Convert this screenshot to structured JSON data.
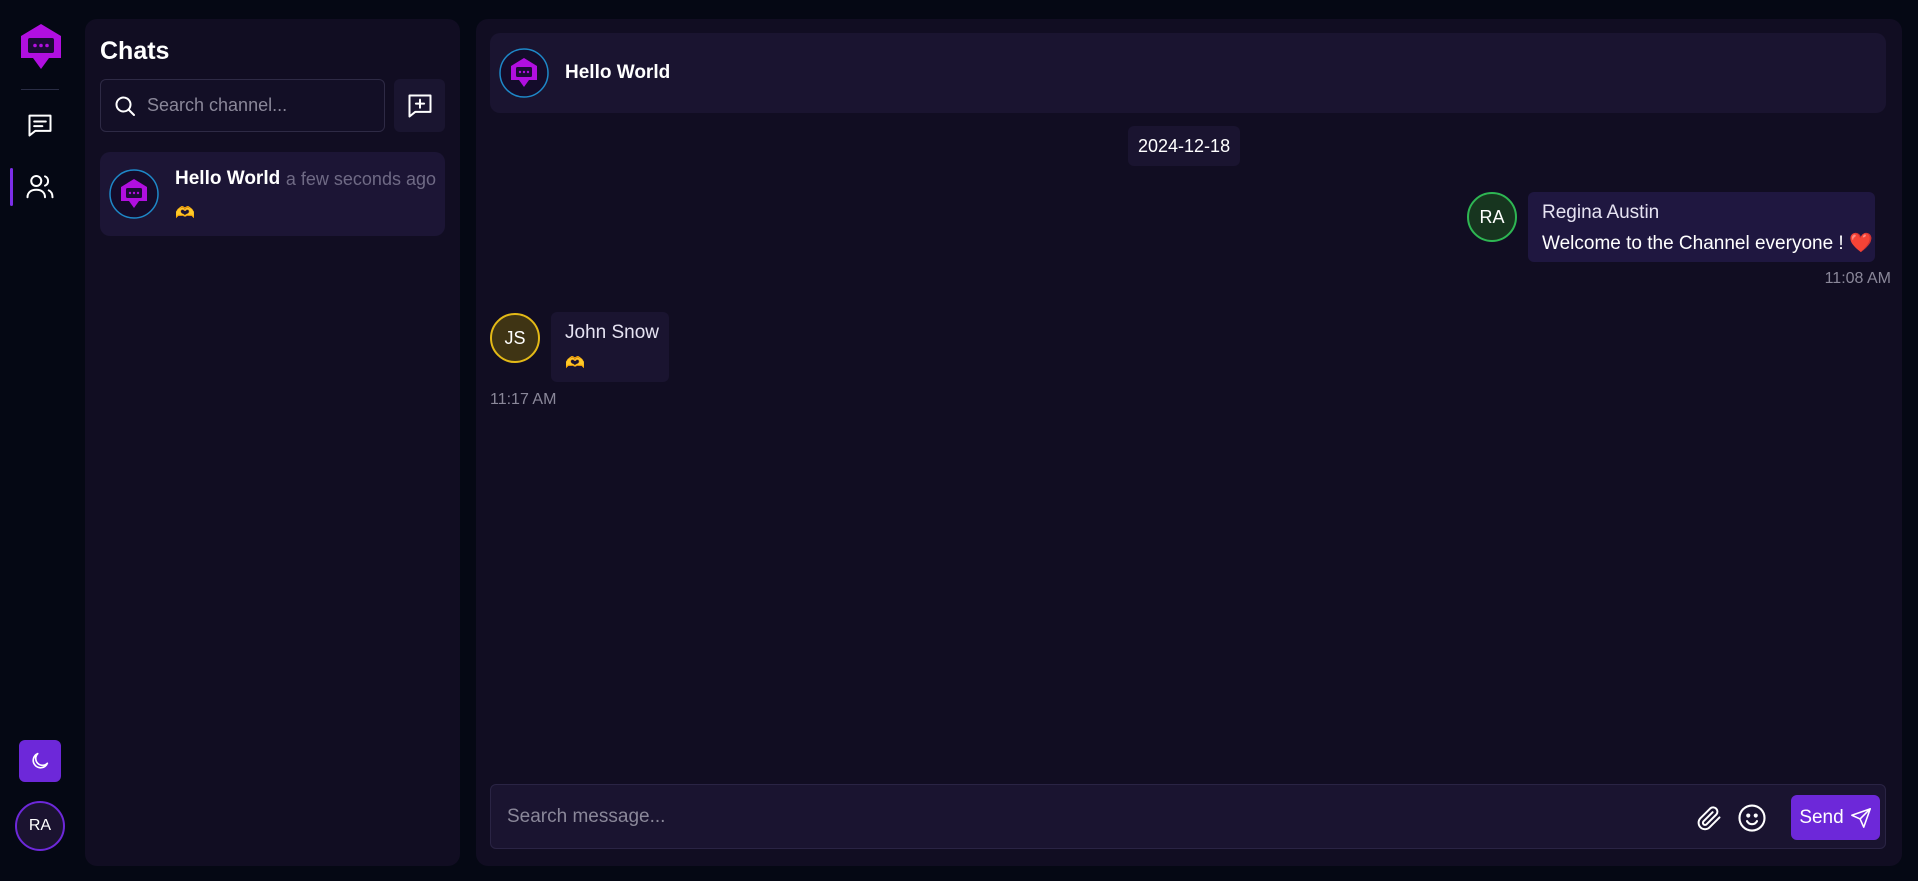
{
  "rail": {
    "user_initials": "RA",
    "accent_color": "#6d28d9"
  },
  "chats": {
    "title": "Chats",
    "search_placeholder": "Search channel...",
    "channels": [
      {
        "name": "Hello World",
        "time": "a few seconds ago",
        "last_message": "🫶"
      }
    ]
  },
  "header": {
    "title": "Hello World"
  },
  "conversation": {
    "date": "2024-12-18",
    "messages": [
      {
        "initials": "RA",
        "sender": "Regina Austin",
        "text": "Welcome to the Channel everyone ! ❤️",
        "time": "11:08 AM",
        "avatar_color": "#2eb653"
      },
      {
        "initials": "JS",
        "sender": "John Snow",
        "text": "🫶",
        "time": "11:17 AM",
        "avatar_color": "#e3b917"
      }
    ]
  },
  "composer": {
    "placeholder": "Search message...",
    "send_label": "Send"
  },
  "icons": [
    "app-logo-icon",
    "chat-list-icon",
    "users-icon",
    "moon-icon",
    "search-icon",
    "new-chat-icon",
    "paperclip-icon",
    "emoji-icon",
    "send-icon"
  ]
}
